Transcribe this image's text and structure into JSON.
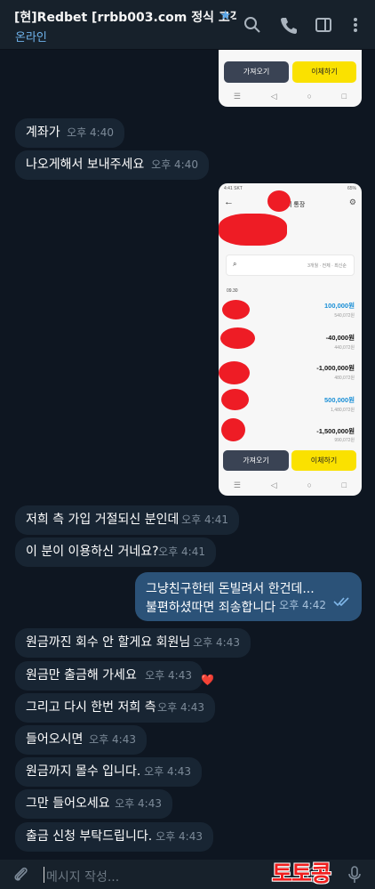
{
  "header": {
    "title": "[현]Redbet [rrbb003.com 정식 고객...",
    "status": "온라인"
  },
  "top_image": {
    "btn_fetch": "가져오기",
    "btn_transfer": "이체하기"
  },
  "bank_image": {
    "status_left": "4:41 SKT",
    "status_right": "65%",
    "title": "의 통장",
    "filter": "3개월 · 전체 · 최신순",
    "date": "09.30",
    "transactions": [
      {
        "amount": "100,000원",
        "balance": "540,072원"
      },
      {
        "amount": "-40,000원",
        "balance": "440,072원"
      },
      {
        "amount": "-1,000,000원",
        "balance": "480,072원"
      },
      {
        "amount": "500,000원",
        "balance": "1,480,072원"
      },
      {
        "amount": "-1,500,000원",
        "balance": "990,072원"
      }
    ],
    "btn_fetch": "가져오기",
    "btn_transfer": "이체하기"
  },
  "messages": [
    {
      "text": "계좌가",
      "time": "오후 4:40"
    },
    {
      "text": "나오게해서 보내주세요",
      "time": "오후 4:40"
    },
    {
      "text": "저희 측 가입 거절되신 분인데",
      "time": "오후 4:41"
    },
    {
      "text": "이 분이 이용하신 거네요?",
      "time": "오후 4:41"
    },
    {
      "text": "원금까진 회수 안 할게요 회원님",
      "time": "오후 4:43"
    },
    {
      "text": "원금만 출금해 가세요",
      "time": "오후 4:43"
    },
    {
      "text": "그리고 다시 한번 저희 측",
      "time": "오후 4:43"
    },
    {
      "text": "들어오시면",
      "time": "오후 4:43"
    },
    {
      "text": "원금까지 몰수 입니다.",
      "time": "오후 4:43"
    },
    {
      "text": "그만 들어오세요",
      "time": "오후 4:43"
    },
    {
      "text": "출금 신청 부탁드립니다.",
      "time": "오후 4:43"
    }
  ],
  "outgoing": {
    "line1": "그냥친구한테 돈빌려서 한건데...",
    "line2": "불편하셨따면 죄송합니다",
    "time": "오후 4:42"
  },
  "reaction": "❤️",
  "input": {
    "placeholder": "메시지 작성..."
  },
  "watermark": "토토콩",
  "colors": {
    "background": "#0e1621",
    "incoming_bubble": "#182533",
    "outgoing_bubble": "#2b5278",
    "accent": "#6fb3ec",
    "redaction": "#ee1c25"
  }
}
